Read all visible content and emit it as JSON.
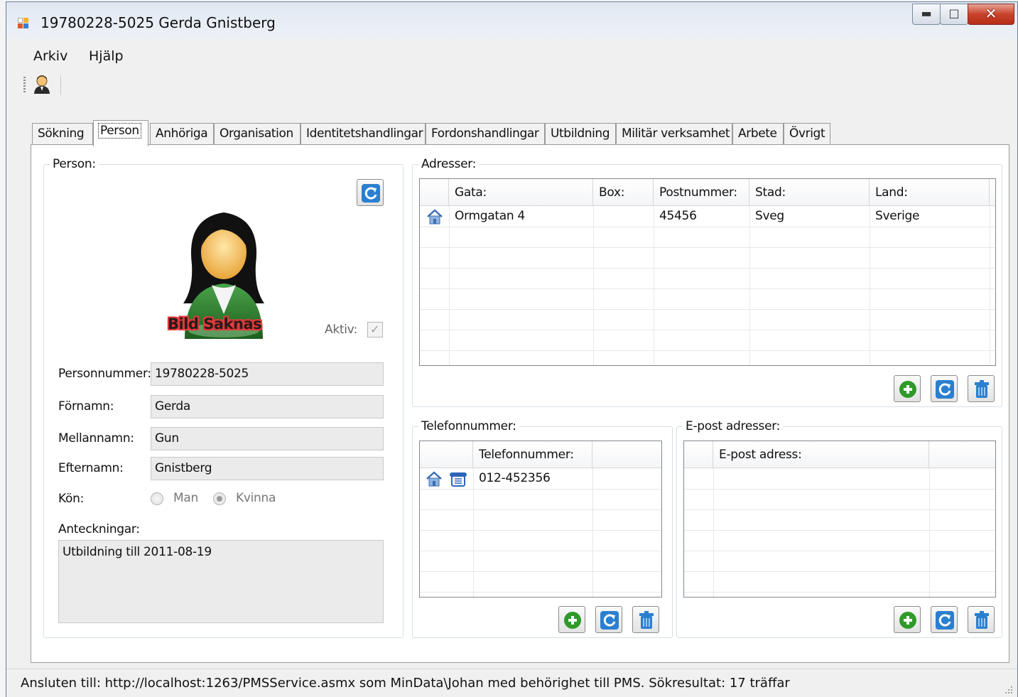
{
  "window": {
    "title": "19780228-5025 Gerda Gnistberg",
    "controls": [
      "minimize",
      "maximize",
      "close"
    ]
  },
  "menu": [
    "Arkiv",
    "Hjälp"
  ],
  "toolbar": {
    "icon": "person-search-icon"
  },
  "tabs": [
    {
      "label": "Sökning"
    },
    {
      "label": "Person",
      "active": true
    },
    {
      "label": "Anhöriga"
    },
    {
      "label": "Organisation"
    },
    {
      "label": "Identitetshandlingar"
    },
    {
      "label": "Fordonshandlingar"
    },
    {
      "label": "Utbildning"
    },
    {
      "label": "Militär verksamhet"
    },
    {
      "label": "Arbete"
    },
    {
      "label": "Övrigt"
    }
  ],
  "person": {
    "group_title": "Person:",
    "photo_caption": "Bild Saknas",
    "active_label": "Aktiv:",
    "active_checked": true,
    "fields": {
      "personnummer_label": "Personnummer:",
      "personnummer": "19780228-5025",
      "fornamn_label": "Förnamn:",
      "fornamn": "Gerda",
      "mellannamn_label": "Mellannamn:",
      "mellannamn": "Gun",
      "efternamn_label": "Efternamn:",
      "efternamn": "Gnistberg"
    },
    "gender": {
      "label": "Kön:",
      "options": [
        "Man",
        "Kvinna"
      ],
      "selected": "Kvinna"
    },
    "notes_label": "Anteckningar:",
    "notes": "Utbildning till 2011-08-19"
  },
  "addresses": {
    "group_title": "Adresser:",
    "columns": [
      "Gata:",
      "Box:",
      "Postnummer:",
      "Stad:",
      "Land:"
    ],
    "rows": [
      {
        "icon": "house-icon",
        "gata": "Ormgatan 4",
        "box": "",
        "postnummer": "45456",
        "stad": "Sveg",
        "land": "Sverige"
      }
    ]
  },
  "phones": {
    "group_title": "Telefonnummer:",
    "columns": [
      "Telefonnummer:"
    ],
    "rows": [
      {
        "icons": [
          "house-icon",
          "telephone-icon"
        ],
        "number": "012-452356"
      }
    ]
  },
  "emails": {
    "group_title": "E-post adresser:",
    "columns": [
      "E-post adress:"
    ],
    "rows": []
  },
  "status": {
    "text": "Ansluten till: http://localhost:1263/PMSService.asmx som MinData\\Johan med behörighet till PMS.  Sökresultat: 17 träffar"
  },
  "colors": {
    "titlebar": "#dfe8f2",
    "close_button": "#c8432c",
    "field_bg": "#ebebeb",
    "add_green": "#2f9a2a",
    "refresh_blue": "#2b7fd0"
  }
}
